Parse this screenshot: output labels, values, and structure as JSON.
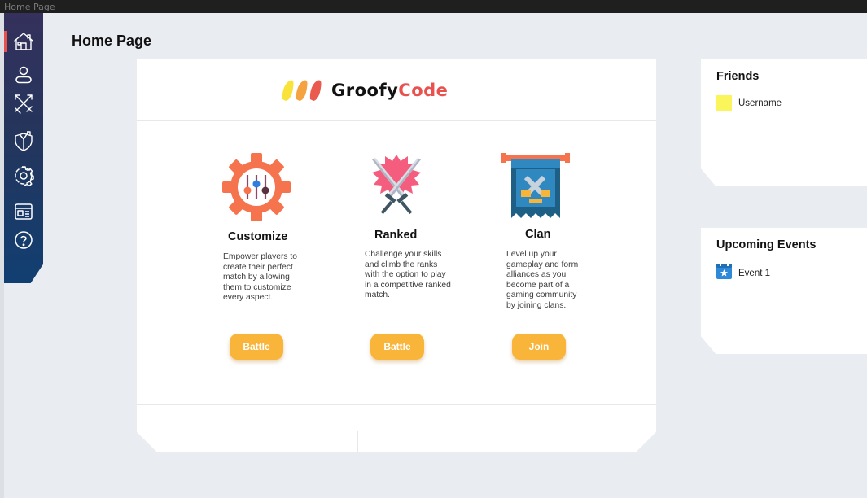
{
  "window": {
    "title": "Home Page"
  },
  "sidebar": {
    "items": [
      {
        "icon": "home-icon",
        "active": true
      },
      {
        "icon": "user-icon",
        "active": false
      },
      {
        "icon": "crossed-arrows-icon",
        "active": false
      },
      {
        "icon": "shield-icon",
        "active": false
      },
      {
        "icon": "gear-icon",
        "active": false
      },
      {
        "icon": "news-icon",
        "active": false
      },
      {
        "icon": "help-icon",
        "active": false
      }
    ],
    "active_color": "#e8504a"
  },
  "page": {
    "title": "Home Page"
  },
  "brand": {
    "name_part1": "Groofy",
    "name_part2": "Code",
    "accent": "#e9504e"
  },
  "features": [
    {
      "icon": "gear-sliders-icon",
      "title": "Customize",
      "description": "Empower players to create their perfect match by allowing them to customize every aspect.",
      "button": "Battle"
    },
    {
      "icon": "crossed-swords-icon",
      "title": "Ranked",
      "description": "Challenge your skills and climb the ranks with the option to play in a competitive ranked match.",
      "button": "Battle"
    },
    {
      "icon": "clan-banner-icon",
      "title": "Clan",
      "description": "Level up your gameplay and form alliances as you become part of a gaming community by joining clans.",
      "button": "Join"
    }
  ],
  "button_color": "#f9b43a",
  "friends": {
    "title": "Friends",
    "items": [
      {
        "name": "Username",
        "avatar_color": "#f9f55a"
      }
    ]
  },
  "events": {
    "title": "Upcoming Events",
    "items": [
      {
        "name": "Event 1",
        "icon": "calendar-star-icon"
      }
    ]
  }
}
